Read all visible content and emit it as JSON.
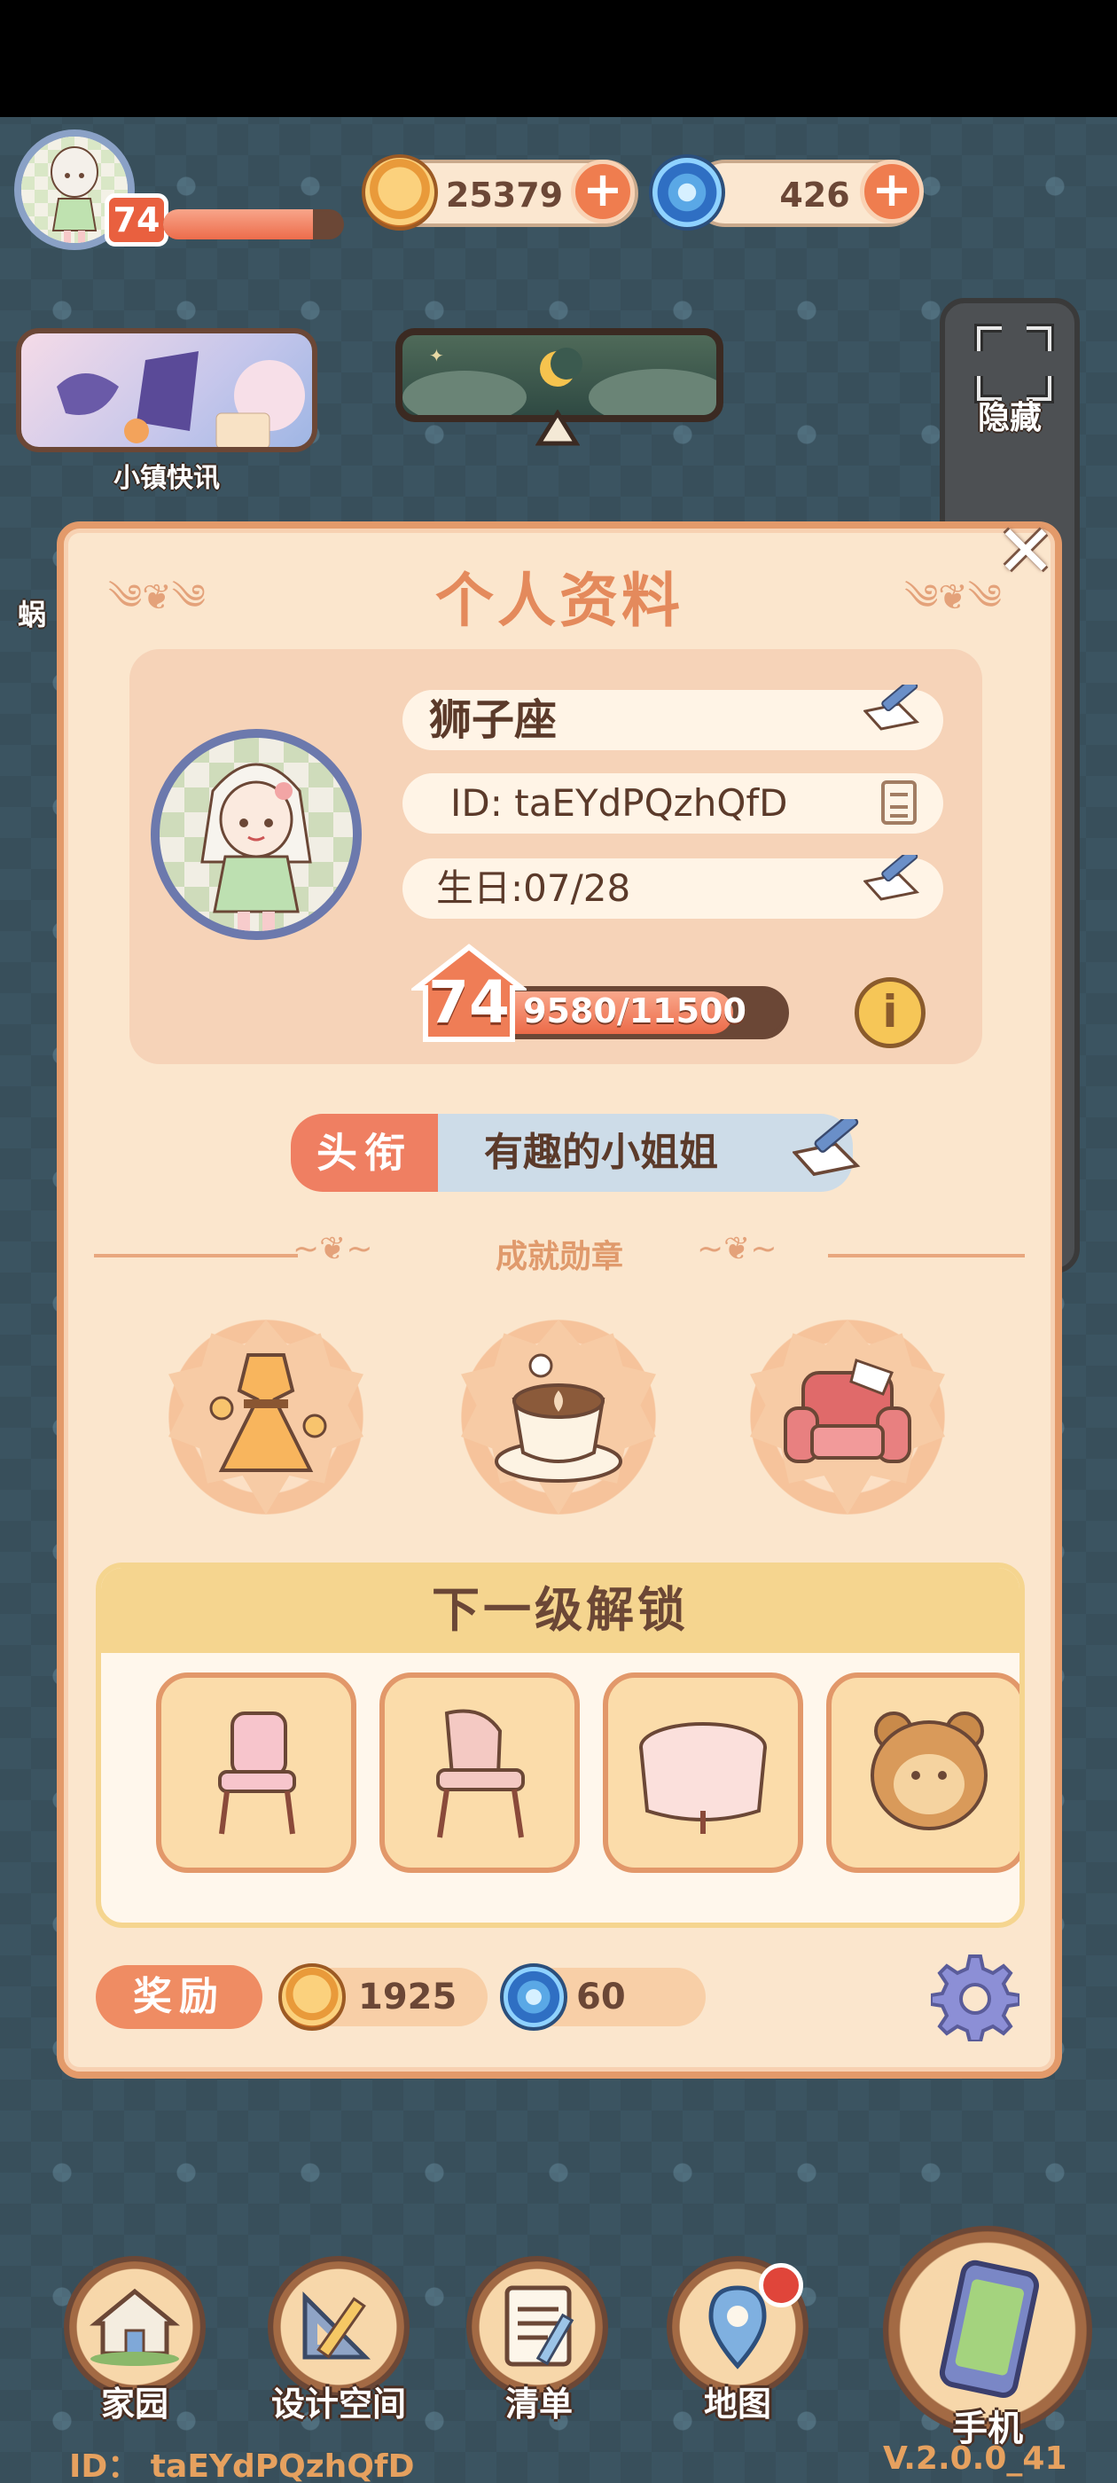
{
  "hud": {
    "level": "74",
    "level_progress": 0.83,
    "coins": "25379",
    "gems": "426",
    "news_label": "小镇快讯",
    "hide_label": "隐藏",
    "left_partial_label": "蜗"
  },
  "profile_modal": {
    "title": "个人资料",
    "name": "狮子座",
    "id_text": "ID: taEYdPQzhQfD",
    "birthday": "生日:07/28",
    "level": "74",
    "exp_text": "9580/11500",
    "exp_progress": 0.833,
    "title_tag_label": "头衔",
    "title_tag_value": "有趣的小姐姐",
    "achievements_label": "成就勋章",
    "medals": [
      "dress-medal-icon",
      "latte-cup-medal-icon",
      "armchair-medal-icon"
    ],
    "next_unlock_label": "下一级解锁",
    "unlock_items": [
      "pink-chair-icon",
      "wooden-chair-icon",
      "round-table-icon",
      "bear-plush-icon"
    ],
    "reward_label": "奖励",
    "reward_coins": "1925",
    "reward_gems": "60"
  },
  "bottom_nav": {
    "items": [
      {
        "label": "家园",
        "icon": "house-icon"
      },
      {
        "label": "设计空间",
        "icon": "ruler-triangle-icon"
      },
      {
        "label": "清单",
        "icon": "checklist-icon"
      },
      {
        "label": "地图",
        "icon": "map-pin-icon"
      },
      {
        "label": "手机",
        "icon": "phone-icon"
      }
    ]
  },
  "footer": {
    "id_text": "ID： taEYdPQzhQfD",
    "version": "V.2.0.0_41"
  },
  "colors": {
    "accent": "#ef7f62",
    "modal_bg": "#fbe6cd",
    "brown_text": "#5b3a2a",
    "background": "#3b5461"
  }
}
